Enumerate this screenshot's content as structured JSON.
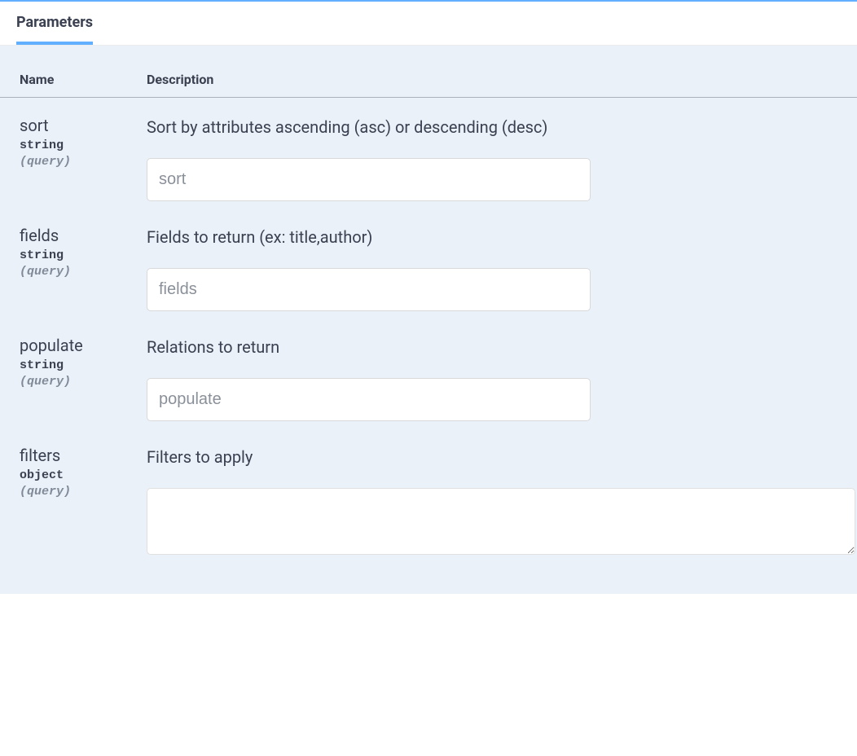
{
  "tab": {
    "label": "Parameters"
  },
  "headers": {
    "name": "Name",
    "description": "Description"
  },
  "params": [
    {
      "name": "sort",
      "type": "string",
      "in": "(query)",
      "description": "Sort by attributes ascending (asc) or descending (desc)",
      "placeholder": "sort"
    },
    {
      "name": "fields",
      "type": "string",
      "in": "(query)",
      "description": "Fields to return (ex: title,author)",
      "placeholder": "fields"
    },
    {
      "name": "populate",
      "type": "string",
      "in": "(query)",
      "description": "Relations to return",
      "placeholder": "populate"
    },
    {
      "name": "filters",
      "type": "object",
      "in": "(query)",
      "description": "Filters to apply",
      "placeholder": ""
    }
  ]
}
